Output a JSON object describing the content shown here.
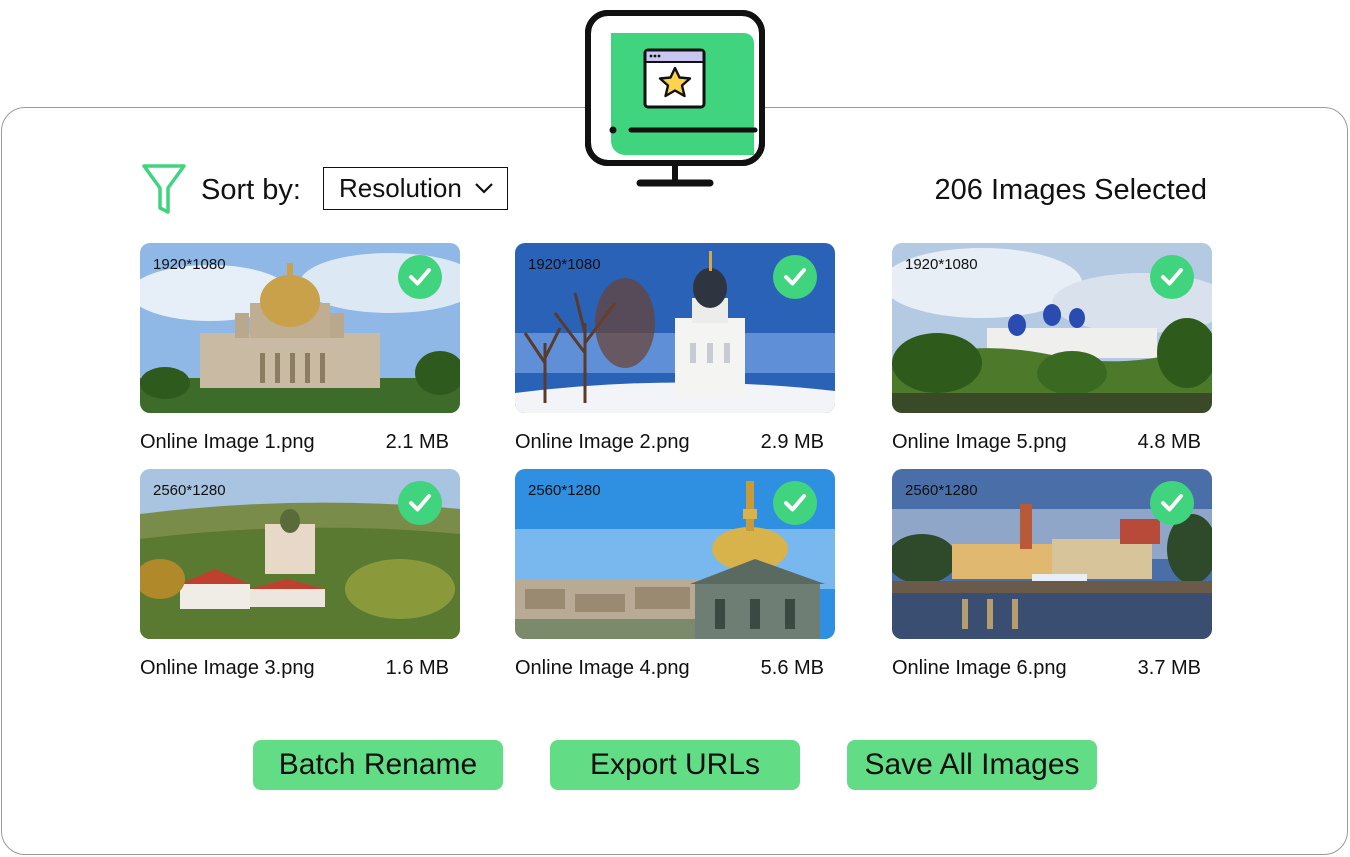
{
  "toolbar": {
    "sort_label": "Sort by:",
    "sort_value": "Resolution",
    "selected_count": "206 Images Selected"
  },
  "colors": {
    "accent": "#40d47e",
    "button": "#62dd86",
    "border": "#9a9a9a"
  },
  "images": [
    {
      "resolution": "1920*1080",
      "name": "Online Image 1.png",
      "size": "2.1 MB",
      "selected": true
    },
    {
      "resolution": "1920*1080",
      "name": "Online Image 2.png",
      "size": "2.9 MB",
      "selected": true
    },
    {
      "resolution": "1920*1080",
      "name": "Online Image 5.png",
      "size": "4.8 MB",
      "selected": true
    },
    {
      "resolution": "2560*1280",
      "name": "Online Image 3.png",
      "size": "1.6 MB",
      "selected": true
    },
    {
      "resolution": "2560*1280",
      "name": "Online Image 4.png",
      "size": "5.6 MB",
      "selected": true
    },
    {
      "resolution": "2560*1280",
      "name": "Online Image 6.png",
      "size": "3.7 MB",
      "selected": true
    }
  ],
  "actions": {
    "batch_rename": "Batch Rename",
    "export_urls": "Export URLs",
    "save_all": "Save All Images"
  },
  "icons": {
    "logo": "monitor-star-icon",
    "filter": "filter-icon",
    "sort_chevron": "chevron-down-icon",
    "checkmark": "check-circle-icon"
  }
}
